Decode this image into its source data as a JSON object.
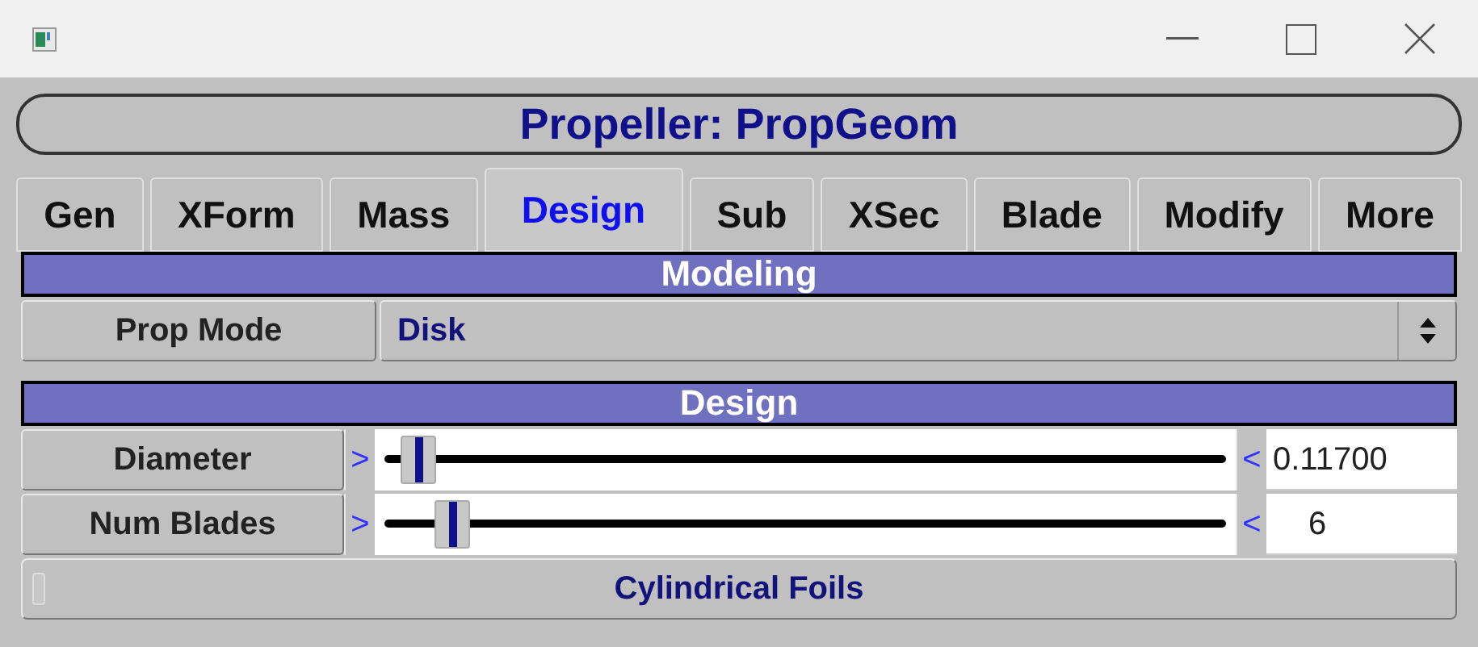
{
  "title": "Propeller: PropGeom",
  "tabs": [
    {
      "label": "Gen",
      "selected": false
    },
    {
      "label": "XForm",
      "selected": false
    },
    {
      "label": "Mass",
      "selected": false
    },
    {
      "label": "Design",
      "selected": true
    },
    {
      "label": "Sub",
      "selected": false
    },
    {
      "label": "XSec",
      "selected": false
    },
    {
      "label": "Blade",
      "selected": false
    },
    {
      "label": "Modify",
      "selected": false
    },
    {
      "label": "More",
      "selected": false
    }
  ],
  "sections": [
    {
      "header": "Modeling",
      "rows": [
        {
          "kind": "choice",
          "label": "Prop Mode",
          "value": "Disk"
        }
      ]
    },
    {
      "header": "Design",
      "rows": [
        {
          "kind": "slider",
          "label": "Diameter",
          "dec": ">",
          "inc": "<",
          "level": 0.04,
          "value": "0.11700"
        },
        {
          "kind": "slider",
          "label": "Num Blades",
          "dec": ">",
          "inc": "<",
          "level": 0.08,
          "value": "6"
        },
        {
          "kind": "toggle",
          "label": "Cylindrical Foils",
          "checked": false
        }
      ]
    }
  ]
}
